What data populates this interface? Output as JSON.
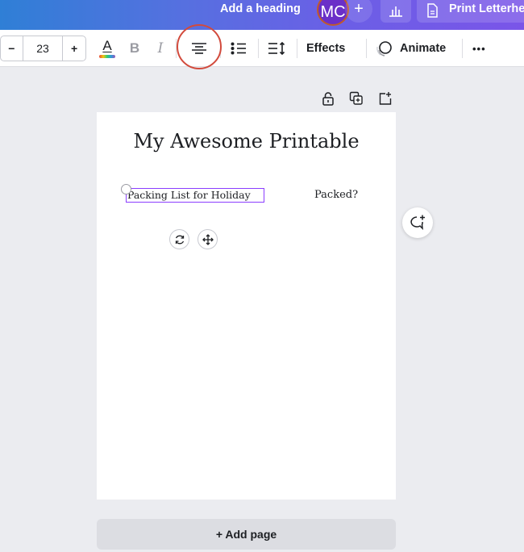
{
  "header": {
    "heading_label": "Add a heading",
    "avatar_initials": "MC",
    "plus_label": "+",
    "print_label": "Print Letterhe"
  },
  "toolbar": {
    "font_size_minus": "−",
    "font_size_value": "23",
    "font_size_plus": "+",
    "text_color_label": "A",
    "bold_label": "B",
    "italic_label": "I",
    "effects_label": "Effects",
    "animate_label": "Animate",
    "more_label": "•••"
  },
  "page": {
    "title": "My Awesome Printable",
    "selected_text": "Packing List for Holiday",
    "packed_label": "Packed?"
  },
  "add_page_label": "+ Add page",
  "colors": {
    "accent": "#8b3dff",
    "annotation": "#d24a3c"
  }
}
